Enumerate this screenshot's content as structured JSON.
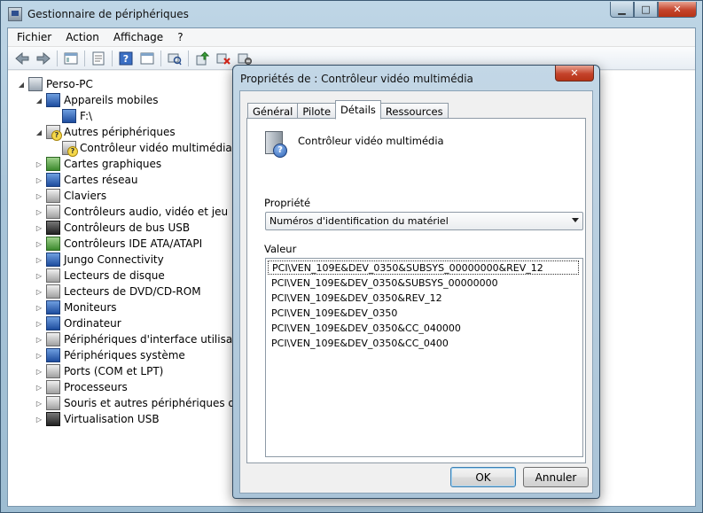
{
  "window": {
    "title": "Gestionnaire de périphériques",
    "buttons": {
      "minimize": "▁",
      "maximize": "□",
      "close": "✕"
    }
  },
  "menu": [
    "Fichier",
    "Action",
    "Affichage",
    "?"
  ],
  "toolbar": [
    "back-icon",
    "forward-icon",
    "tree-view-icon",
    "properties-icon",
    "help-icon",
    "console-icon",
    "scan-hardware-icon",
    "update-driver-icon",
    "uninstall-icon",
    "disable-icon"
  ],
  "tree": {
    "root": "Perso-PC",
    "items": [
      {
        "label": "Appareils mobiles",
        "level": 1,
        "expanded": true,
        "icon": "mobile-icon"
      },
      {
        "label": "F:\\",
        "level": 2,
        "icon": "mobile-device-icon"
      },
      {
        "label": "Autres périphériques",
        "level": 1,
        "expanded": true,
        "icon": "unknown-device-icon"
      },
      {
        "label": "Contrôleur vidéo multimédia",
        "level": 2,
        "icon": "unknown-device-icon"
      },
      {
        "label": "Cartes graphiques",
        "level": 1,
        "icon": "display-adapter-icon"
      },
      {
        "label": "Cartes réseau",
        "level": 1,
        "icon": "network-adapter-icon"
      },
      {
        "label": "Claviers",
        "level": 1,
        "icon": "keyboard-icon"
      },
      {
        "label": "Contrôleurs audio, vidéo et jeu",
        "level": 1,
        "icon": "audio-icon"
      },
      {
        "label": "Contrôleurs de bus USB",
        "level": 1,
        "icon": "usb-icon"
      },
      {
        "label": "Contrôleurs IDE ATA/ATAPI",
        "level": 1,
        "icon": "ide-icon"
      },
      {
        "label": "Jungo Connectivity",
        "level": 1,
        "icon": "jungo-icon"
      },
      {
        "label": "Lecteurs de disque",
        "level": 1,
        "icon": "disk-drive-icon"
      },
      {
        "label": "Lecteurs de DVD/CD-ROM",
        "level": 1,
        "icon": "dvd-icon"
      },
      {
        "label": "Moniteurs",
        "level": 1,
        "icon": "monitor-icon"
      },
      {
        "label": "Ordinateur",
        "level": 1,
        "icon": "computer-icon"
      },
      {
        "label": "Périphériques d'interface utilisateur",
        "level": 1,
        "icon": "hid-icon"
      },
      {
        "label": "Périphériques système",
        "level": 1,
        "icon": "system-icon"
      },
      {
        "label": "Ports (COM et LPT)",
        "level": 1,
        "icon": "port-icon"
      },
      {
        "label": "Processeurs",
        "level": 1,
        "icon": "processor-icon"
      },
      {
        "label": "Souris et autres périphériques de poi",
        "level": 1,
        "icon": "mouse-icon"
      },
      {
        "label": "Virtualisation USB",
        "level": 1,
        "icon": "usb-virtual-icon"
      }
    ]
  },
  "dialog": {
    "title": "Propriétés de : Contrôleur vidéo multimédia",
    "close": "✕",
    "tabs": [
      "Général",
      "Pilote",
      "Détails",
      "Ressources"
    ],
    "active_tab": "Détails",
    "device_name": "Contrôleur vidéo multimédia",
    "property_label": "Propriété",
    "property_value": "Numéros d'identification du matériel",
    "value_label": "Valeur",
    "values": [
      "PCI\\VEN_109E&DEV_0350&SUBSYS_00000000&REV_12",
      "PCI\\VEN_109E&DEV_0350&SUBSYS_00000000",
      "PCI\\VEN_109E&DEV_0350&REV_12",
      "PCI\\VEN_109E&DEV_0350",
      "PCI\\VEN_109E&DEV_0350&CC_040000",
      "PCI\\VEN_109E&DEV_0350&CC_0400"
    ],
    "selected_index": 0,
    "ok_label": "OK",
    "cancel_label": "Annuler"
  }
}
